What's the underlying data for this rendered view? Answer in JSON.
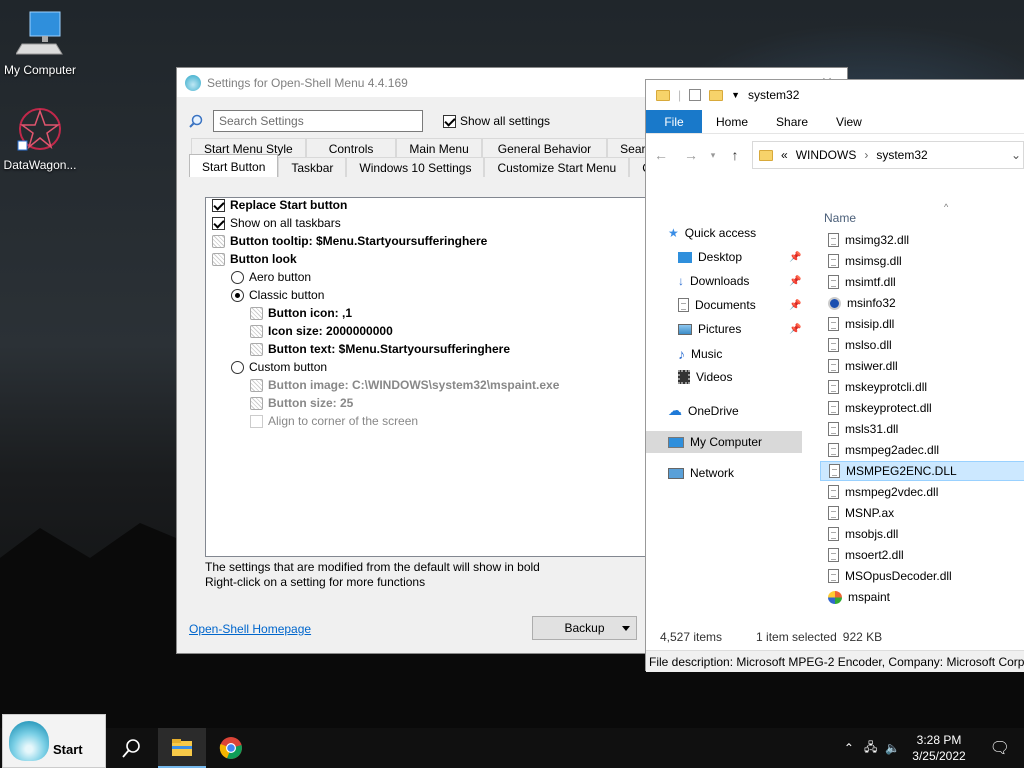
{
  "desktop": {
    "icons": [
      {
        "label": "My Computer"
      },
      {
        "label": "DataWagon..."
      }
    ]
  },
  "settings": {
    "title": "Settings for Open-Shell Menu 4.4.169",
    "search_placeholder": "Search Settings",
    "show_all_label": "Show all settings",
    "tabs_row1": [
      "Start Menu Style",
      "Controls",
      "Main Menu",
      "General Behavior",
      "Search"
    ],
    "tabs_row2": [
      "Start Button",
      "Taskbar",
      "Windows 10 Settings",
      "Customize Start Menu",
      "Conte"
    ],
    "tree": [
      {
        "text": "Replace Start button"
      },
      {
        "text": "Show on all taskbars"
      },
      {
        "text": "Button tooltip: $Menu.Startyoursufferinghere"
      },
      {
        "text": "Button look"
      },
      {
        "text": "Aero button"
      },
      {
        "text": "Classic button"
      },
      {
        "text": "Button icon: ,1"
      },
      {
        "text": "Icon size: 2000000000"
      },
      {
        "text": "Button text: $Menu.Startyoursufferinghere"
      },
      {
        "text": "Custom button"
      },
      {
        "text": "Button image: C:\\WINDOWS\\system32\\mspaint.exe"
      },
      {
        "text": "Button size: 25"
      },
      {
        "text": "Align to corner of the screen"
      }
    ],
    "hint1": "The settings that are modified from the default will show in bold",
    "hint2": "Right-click on a setting for more functions",
    "homepage_link": "Open-Shell Homepage",
    "backup_label": "Backup"
  },
  "explorer": {
    "title": "system32",
    "ribbon": {
      "file": "File",
      "tabs": [
        "Home",
        "Share",
        "View"
      ]
    },
    "breadcrumb": {
      "prefix": "«",
      "parts": [
        "WINDOWS",
        "system32"
      ]
    },
    "nav": [
      {
        "label": "Quick access",
        "icon": "star-icon"
      },
      {
        "label": "Desktop",
        "icon": "desktop-icon",
        "pinned": true
      },
      {
        "label": "Downloads",
        "icon": "download-icon",
        "pinned": true
      },
      {
        "label": "Documents",
        "icon": "documents-icon",
        "pinned": true
      },
      {
        "label": "Pictures",
        "icon": "pictures-icon",
        "pinned": true
      },
      {
        "label": "Music",
        "icon": "music-icon"
      },
      {
        "label": "Videos",
        "icon": "videos-icon"
      },
      {
        "label": "OneDrive",
        "icon": "cloud-icon"
      },
      {
        "label": "My Computer",
        "icon": "computer-icon"
      },
      {
        "label": "Network",
        "icon": "network-icon"
      }
    ],
    "column_header": "Name",
    "files": [
      "msimg32.dll",
      "msimsg.dll",
      "msimtf.dll",
      "msinfo32",
      "msisip.dll",
      "mslso.dll",
      "msiwer.dll",
      "mskeyprotcli.dll",
      "mskeyprotect.dll",
      "msls31.dll",
      "msmpeg2adec.dll",
      "MSMPEG2ENC.DLL",
      "msmpeg2vdec.dll",
      "MSNP.ax",
      "msobjs.dll",
      "msoert2.dll",
      "MSOpusDecoder.dll",
      "mspaint"
    ],
    "selected_file": "MSMPEG2ENC.DLL",
    "status": {
      "count": "4,527 items",
      "selected": "1 item selected",
      "size": "922 KB"
    },
    "file_description": "File description: Microsoft MPEG-2 Encoder, Company: Microsoft Corpo"
  },
  "taskbar": {
    "start_label": "Start",
    "time": "3:28 PM",
    "date": "3/25/2022"
  },
  "colors": {
    "ribbon_file": "#1979ca",
    "selection": "#cce8ff",
    "link": "#0066cc"
  }
}
